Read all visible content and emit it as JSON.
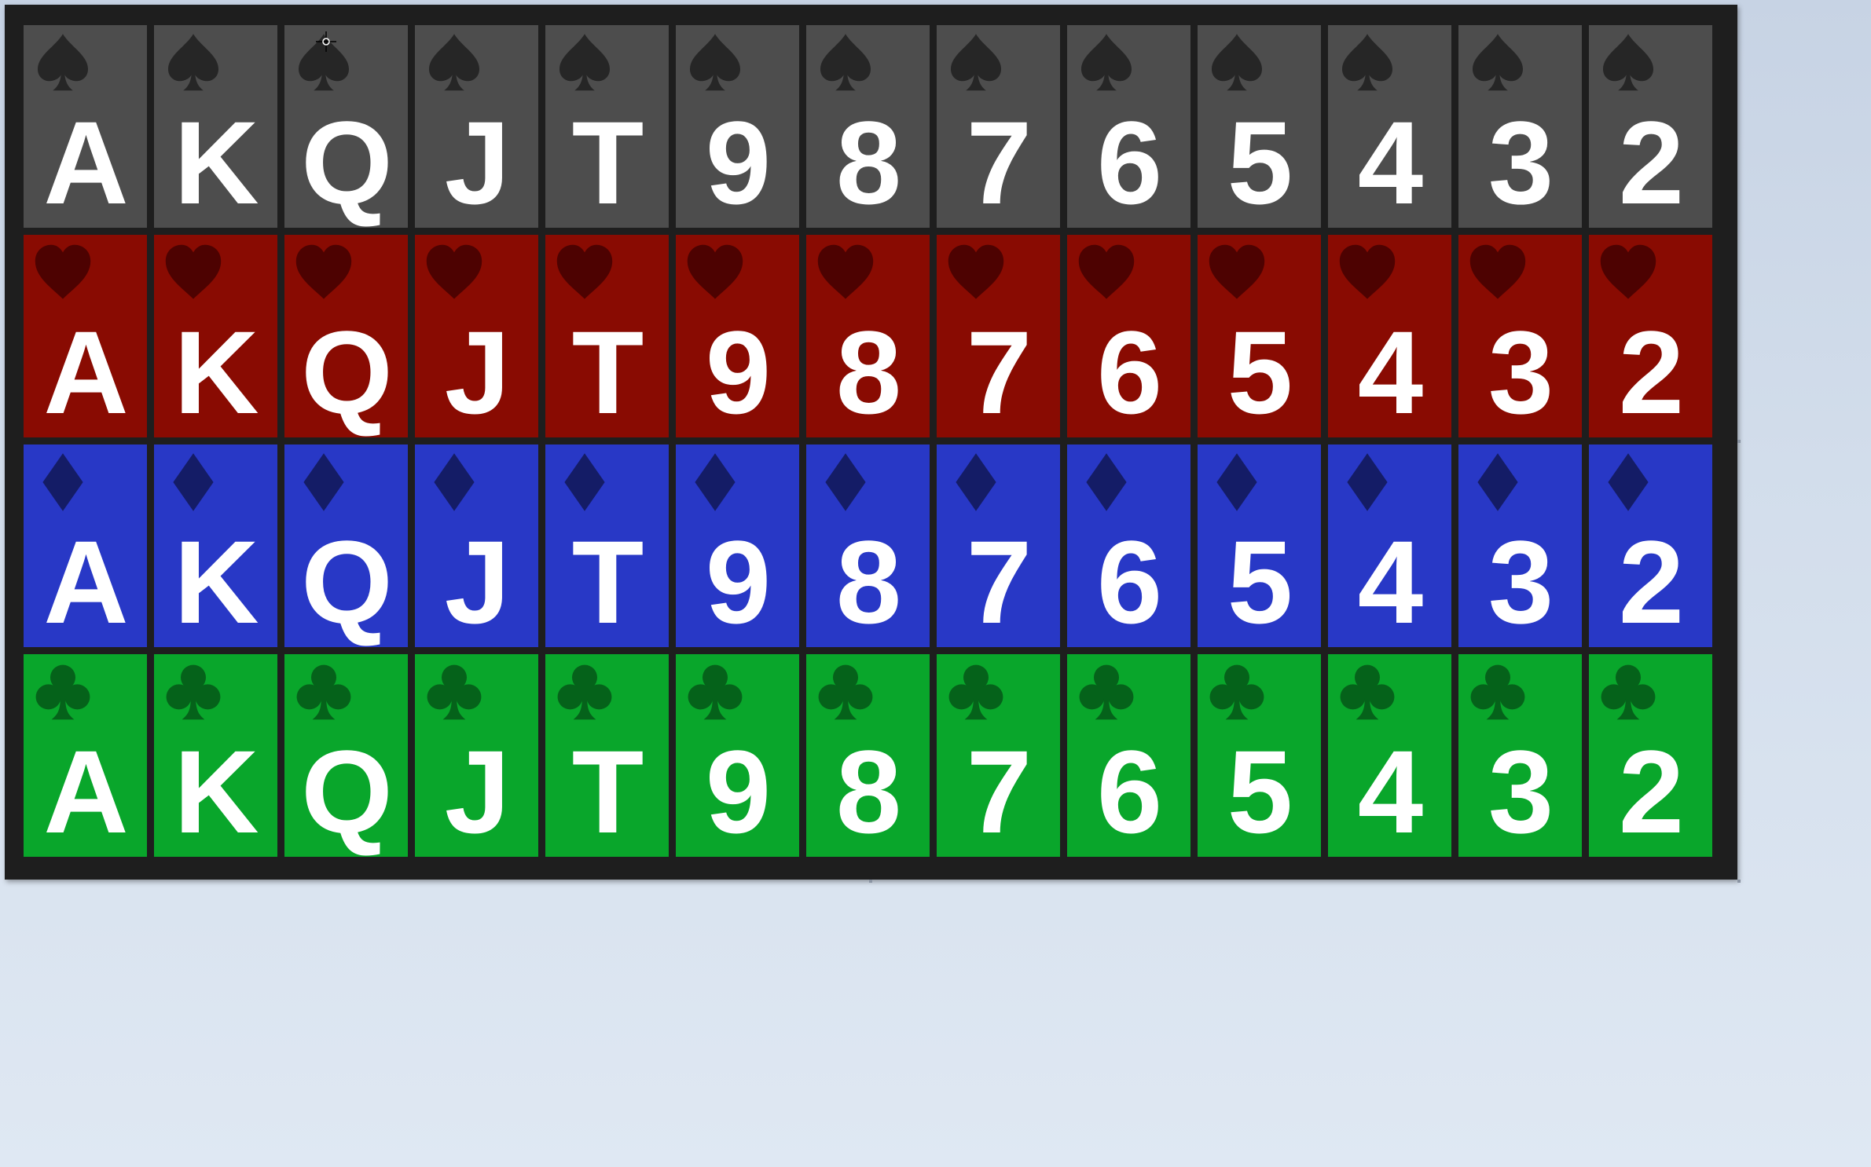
{
  "ranks": [
    "A",
    "K",
    "Q",
    "J",
    "T",
    "9",
    "8",
    "7",
    "6",
    "5",
    "4",
    "3",
    "2"
  ],
  "panel_color": "#1e1e1e",
  "rank_text_color": "#ffffff",
  "suits": [
    {
      "key": "spades",
      "icon": "spade-icon",
      "card_color": "#4d4d4d",
      "pip_color": "#262626"
    },
    {
      "key": "hearts",
      "icon": "heart-icon",
      "card_color": "#890b02",
      "pip_color": "#4d0201"
    },
    {
      "key": "diamonds",
      "icon": "diamond-icon",
      "card_color": "#2838c6",
      "pip_color": "#141c66"
    },
    {
      "key": "clubs",
      "icon": "club-icon",
      "card_color": "#09a62b",
      "pip_color": "#05621a"
    }
  ]
}
